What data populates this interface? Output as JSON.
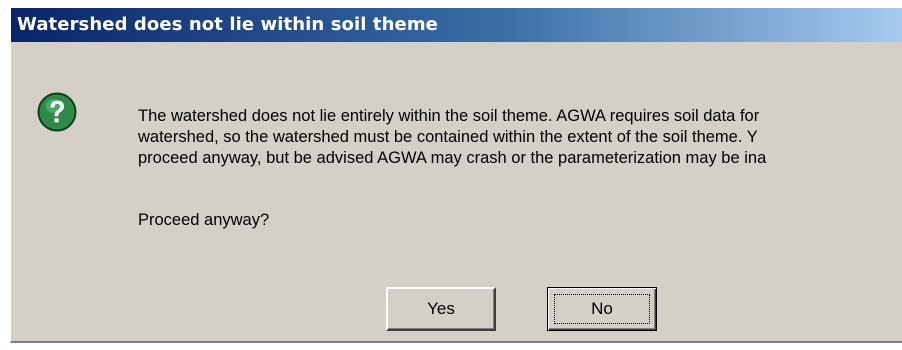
{
  "dialog": {
    "title": "Watershed does not lie within soil theme",
    "icon": "question-icon",
    "message_lines": [
      "The watershed does not lie entirely within the soil theme.  AGWA requires soil data for",
      "watershed, so the watershed must be contained within the extent of the soil theme.  Y",
      "proceed anyway, but be advised AGWA may crash or the parameterization may be ina"
    ],
    "question": "Proceed anyway?",
    "buttons": {
      "yes_label": "Yes",
      "no_label": "No"
    },
    "colors": {
      "titlebar_start": "#0a246a",
      "titlebar_end": "#a6caf0",
      "face": "#d4d0c8",
      "icon_green": "#2f8a4a"
    }
  }
}
